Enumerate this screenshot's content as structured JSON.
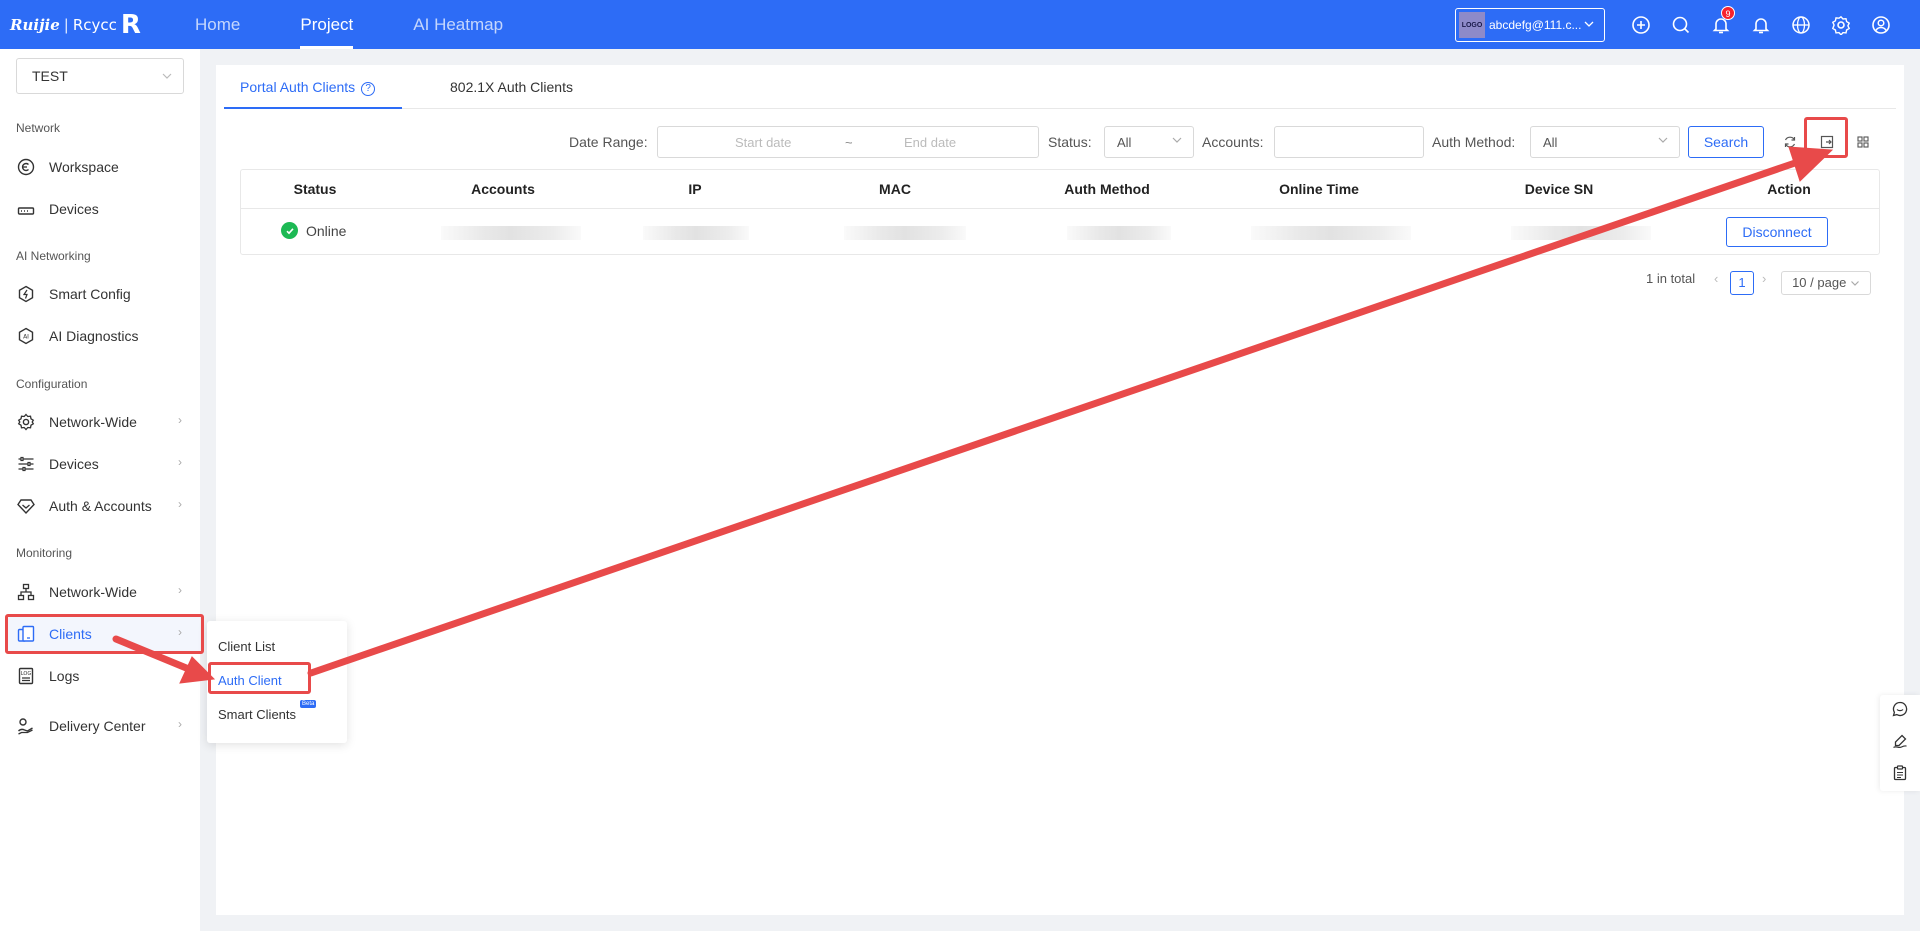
{
  "header": {
    "logo_brand": "Ruijie",
    "logo_sep": "|",
    "logo_product": "Rcycc",
    "nav": [
      "Home",
      "Project",
      "AI Heatmap"
    ],
    "active_nav": "Project",
    "account_logo": "LOGO",
    "account_label": "abcdefg@111.c...",
    "notification_count": "9",
    "icons": [
      "plus-circle-icon",
      "search-icon",
      "bell-icon",
      "bell-outline-icon",
      "globe-icon",
      "gear-icon",
      "user-circle-icon"
    ]
  },
  "sidebar": {
    "project": "TEST",
    "sections": {
      "network": "Network",
      "ai_networking": "AI Networking",
      "configuration": "Configuration",
      "monitoring": "Monitoring"
    },
    "items": {
      "workspace": "Workspace",
      "devices": "Devices",
      "smart_config": "Smart Config",
      "ai_diagnostics": "AI Diagnostics",
      "cfg_network_wide": "Network-Wide",
      "cfg_devices": "Devices",
      "auth_accounts": "Auth & Accounts",
      "mon_network_wide": "Network-Wide",
      "clients": "Clients",
      "logs": "Logs",
      "delivery_center": "Delivery Center"
    },
    "submenu": {
      "client_list": "Client List",
      "auth_client": "Auth Client",
      "smart_clients": "Smart Clients",
      "beta": "Beta"
    }
  },
  "tabs": {
    "portal": "Portal Auth Clients",
    "dot1x": "802.1X Auth Clients"
  },
  "filters": {
    "date_range_label": "Date Range:",
    "start_placeholder": "Start date",
    "tilde": "~",
    "end_placeholder": "End date",
    "status_label": "Status:",
    "status_value": "All",
    "accounts_label": "Accounts:",
    "accounts_value": "",
    "auth_method_label": "Auth Method:",
    "auth_method_value": "All",
    "search_button": "Search"
  },
  "table": {
    "columns": [
      "Status",
      "Accounts",
      "IP",
      "MAC",
      "Auth Method",
      "Online Time",
      "Device SN",
      "Action"
    ],
    "rows": [
      {
        "status": "Online",
        "action": "Disconnect"
      }
    ]
  },
  "pagination": {
    "total": "1 in total",
    "current_page": "1",
    "page_size": "10 / page"
  },
  "colors": {
    "brand": "#2d6cf6",
    "annotation": "#e84a4a",
    "online": "#1db954"
  }
}
